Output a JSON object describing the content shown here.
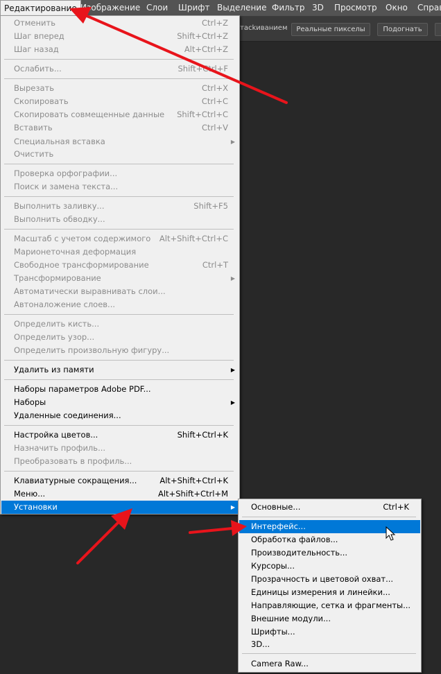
{
  "menubar": {
    "items": [
      {
        "label": "Редактирование"
      },
      {
        "label": "Изображение"
      },
      {
        "label": "Слои"
      },
      {
        "label": "Шрифт"
      },
      {
        "label": "Выделение"
      },
      {
        "label": "Фильтр"
      },
      {
        "label": "3D"
      },
      {
        "label": "Просмотр"
      },
      {
        "label": "Окно"
      },
      {
        "label": "Справ"
      }
    ]
  },
  "options_bar": {
    "fragment": "тасkиванием",
    "actual_pixels": "Реальные пикселы",
    "fit": "Подогнать"
  },
  "edit_menu": {
    "items": [
      {
        "label": "Отменить",
        "shortcut": "Ctrl+Z"
      },
      {
        "label": "Шаг вперед",
        "shortcut": "Shift+Ctrl+Z"
      },
      {
        "label": "Шаг назад",
        "shortcut": "Alt+Ctrl+Z"
      },
      {
        "label": "Ослабить...",
        "shortcut": "Shift+Ctrl+F"
      },
      {
        "label": "Вырезать",
        "shortcut": "Ctrl+X"
      },
      {
        "label": "Скопировать",
        "shortcut": "Ctrl+C"
      },
      {
        "label": "Скопировать совмещенные данные",
        "shortcut": "Shift+Ctrl+C"
      },
      {
        "label": "Вставить",
        "shortcut": "Ctrl+V"
      },
      {
        "label": "Специальная вставка",
        "shortcut": ""
      },
      {
        "label": "Очистить",
        "shortcut": ""
      },
      {
        "label": "Проверка орфографии...",
        "shortcut": ""
      },
      {
        "label": "Поиск и замена текста...",
        "shortcut": ""
      },
      {
        "label": "Выполнить заливку...",
        "shortcut": "Shift+F5"
      },
      {
        "label": "Выполнить обводку...",
        "shortcut": ""
      },
      {
        "label": "Масштаб с учетом содержимого",
        "shortcut": "Alt+Shift+Ctrl+C"
      },
      {
        "label": "Марионеточная деформация",
        "shortcut": ""
      },
      {
        "label": "Свободное трансформирование",
        "shortcut": "Ctrl+T"
      },
      {
        "label": "Трансформирование",
        "shortcut": ""
      },
      {
        "label": "Автоматически выравнивать слои...",
        "shortcut": ""
      },
      {
        "label": "Автоналожение слоев...",
        "shortcut": ""
      },
      {
        "label": "Определить кисть...",
        "shortcut": ""
      },
      {
        "label": "Определить узор...",
        "shortcut": ""
      },
      {
        "label": "Определить произвольную фигуру...",
        "shortcut": ""
      },
      {
        "label": "Удалить из памяти",
        "shortcut": ""
      },
      {
        "label": "Наборы параметров Adobe PDF...",
        "shortcut": ""
      },
      {
        "label": "Наборы",
        "shortcut": ""
      },
      {
        "label": "Удаленные соединения...",
        "shortcut": ""
      },
      {
        "label": "Настройка цветов...",
        "shortcut": "Shift+Ctrl+K"
      },
      {
        "label": "Назначить профиль...",
        "shortcut": ""
      },
      {
        "label": "Преобразовать в профиль...",
        "shortcut": ""
      },
      {
        "label": "Клавиатурные сокращения...",
        "shortcut": "Alt+Shift+Ctrl+K"
      },
      {
        "label": "Меню...",
        "shortcut": "Alt+Shift+Ctrl+M"
      },
      {
        "label": "Установки",
        "shortcut": ""
      }
    ]
  },
  "submenu": {
    "items": [
      {
        "label": "Основные...",
        "shortcut": "Ctrl+K"
      },
      {
        "label": "Интерфейс...",
        "shortcut": ""
      },
      {
        "label": "Обработка файлов...",
        "shortcut": ""
      },
      {
        "label": "Производительность...",
        "shortcut": ""
      },
      {
        "label": "Курсоры...",
        "shortcut": ""
      },
      {
        "label": "Прозрачность и цветовой охват...",
        "shortcut": ""
      },
      {
        "label": "Единицы измерения и линейки...",
        "shortcut": ""
      },
      {
        "label": "Направляющие, сетка и фрагменты...",
        "shortcut": ""
      },
      {
        "label": "Внешние модули...",
        "shortcut": ""
      },
      {
        "label": "Шрифты...",
        "shortcut": ""
      },
      {
        "label": "3D...",
        "shortcut": ""
      },
      {
        "label": "Camera Raw...",
        "shortcut": ""
      }
    ]
  },
  "colors": {
    "highlight": "#0078d7",
    "annotation_arrow": "#e8141b",
    "menubar_bg": "#535353",
    "canvas_bg": "#282828",
    "menu_bg": "#f0f0f0"
  }
}
